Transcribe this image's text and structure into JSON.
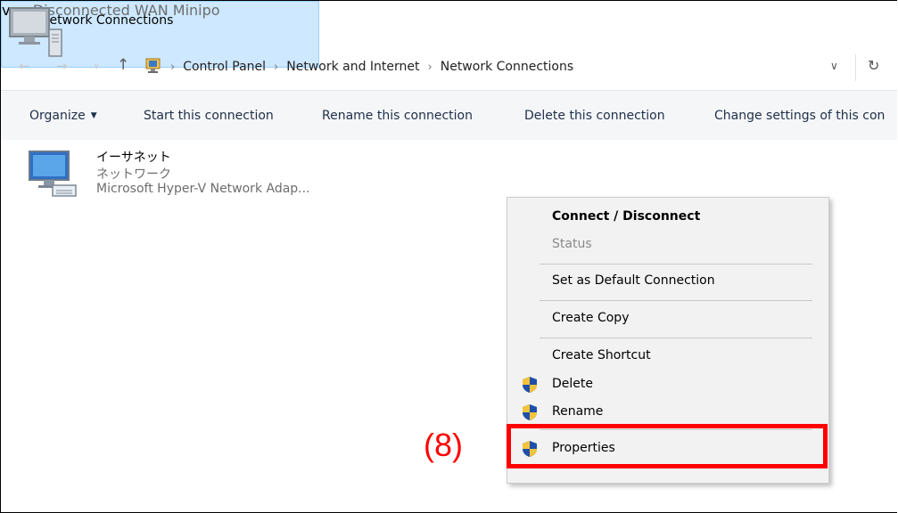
{
  "window": {
    "title": "Network Connections"
  },
  "address": {
    "crumbs": [
      "Control Panel",
      "Network and Internet",
      "Network Connections"
    ]
  },
  "commands": {
    "organize": "Organize",
    "start": "Start this connection",
    "rename": "Rename this connection",
    "delete": "Delete this connection",
    "change": "Change settings of this con"
  },
  "items": [
    {
      "name": "イーサネット",
      "status": "ネットワーク",
      "device": "Microsoft Hyper-V Network Adap..."
    },
    {
      "name": "vpn",
      "status": "Disconnected",
      "device": "WAN Minipo"
    }
  ],
  "context_menu": {
    "connect": "Connect / Disconnect",
    "status": "Status",
    "set_default": "Set as Default Connection",
    "create_copy": "Create Copy",
    "create_shortcut": "Create Shortcut",
    "delete": "Delete",
    "rename": "Rename",
    "properties": "Properties"
  },
  "annotation": {
    "step": "(8)"
  },
  "colors": {
    "selection": "#cde8ff",
    "highlight": "#ff0000",
    "cmdbar": "#f5f6f7"
  }
}
